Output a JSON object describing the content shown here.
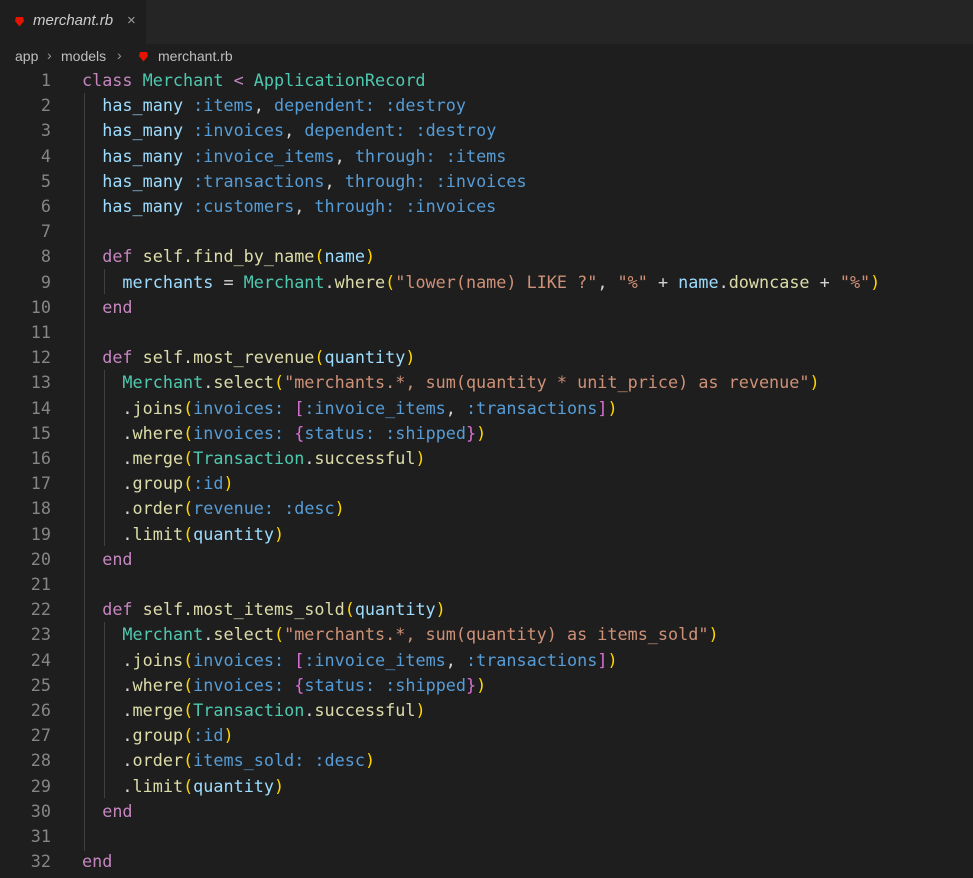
{
  "tab": {
    "title": "merchant.rb",
    "close": "×"
  },
  "breadcrumb": {
    "items": [
      "app",
      "models",
      "merchant.rb"
    ],
    "separator": "›"
  },
  "colors": {
    "background": "#1e1e1e",
    "keyword": "#c586c0",
    "type": "#4ec9b0",
    "symbol": "#569cd6",
    "function": "#dcdcaa",
    "variable": "#9cdcfe",
    "string": "#ce9178",
    "ruby_icon": "#e51400"
  },
  "lines": [
    {
      "n": "1",
      "t": [
        [
          "kw",
          "class "
        ],
        [
          "ty",
          "Merchant"
        ],
        [
          "pl",
          " "
        ],
        [
          "kw",
          "<"
        ],
        [
          "pl",
          " "
        ],
        [
          "ty",
          "ApplicationRecord"
        ]
      ]
    },
    {
      "n": "2",
      "t": [
        [
          "pl",
          "  "
        ],
        [
          "var",
          "has_many"
        ],
        [
          "pl",
          " "
        ],
        [
          "sym",
          ":items"
        ],
        [
          "pl",
          ", "
        ],
        [
          "sym",
          "dependent:"
        ],
        [
          "pl",
          " "
        ],
        [
          "sym",
          ":destroy"
        ]
      ]
    },
    {
      "n": "3",
      "t": [
        [
          "pl",
          "  "
        ],
        [
          "var",
          "has_many"
        ],
        [
          "pl",
          " "
        ],
        [
          "sym",
          ":invoices"
        ],
        [
          "pl",
          ", "
        ],
        [
          "sym",
          "dependent:"
        ],
        [
          "pl",
          " "
        ],
        [
          "sym",
          ":destroy"
        ]
      ]
    },
    {
      "n": "4",
      "t": [
        [
          "pl",
          "  "
        ],
        [
          "var",
          "has_many"
        ],
        [
          "pl",
          " "
        ],
        [
          "sym",
          ":invoice_items"
        ],
        [
          "pl",
          ", "
        ],
        [
          "sym",
          "through:"
        ],
        [
          "pl",
          " "
        ],
        [
          "sym",
          ":items"
        ]
      ]
    },
    {
      "n": "5",
      "t": [
        [
          "pl",
          "  "
        ],
        [
          "var",
          "has_many"
        ],
        [
          "pl",
          " "
        ],
        [
          "sym",
          ":transactions"
        ],
        [
          "pl",
          ", "
        ],
        [
          "sym",
          "through:"
        ],
        [
          "pl",
          " "
        ],
        [
          "sym",
          ":invoices"
        ]
      ]
    },
    {
      "n": "6",
      "t": [
        [
          "pl",
          "  "
        ],
        [
          "var",
          "has_many"
        ],
        [
          "pl",
          " "
        ],
        [
          "sym",
          ":customers"
        ],
        [
          "pl",
          ", "
        ],
        [
          "sym",
          "through:"
        ],
        [
          "pl",
          " "
        ],
        [
          "sym",
          ":invoices"
        ]
      ]
    },
    {
      "n": "7",
      "t": []
    },
    {
      "n": "8",
      "t": [
        [
          "pl",
          "  "
        ],
        [
          "kw",
          "def"
        ],
        [
          "pl",
          " "
        ],
        [
          "fn",
          "self.find_by_name"
        ],
        [
          "br1",
          "("
        ],
        [
          "var",
          "name"
        ],
        [
          "br1",
          ")"
        ]
      ]
    },
    {
      "n": "9",
      "t": [
        [
          "pl",
          "    "
        ],
        [
          "var",
          "merchants"
        ],
        [
          "pl",
          " = "
        ],
        [
          "ty",
          "Merchant"
        ],
        [
          "pl",
          "."
        ],
        [
          "fn",
          "where"
        ],
        [
          "br1",
          "("
        ],
        [
          "str",
          "\"lower(name) LIKE ?\""
        ],
        [
          "pl",
          ", "
        ],
        [
          "str",
          "\"%\""
        ],
        [
          "pl",
          " + "
        ],
        [
          "var",
          "name"
        ],
        [
          "pl",
          "."
        ],
        [
          "fn",
          "downcase"
        ],
        [
          "pl",
          " + "
        ],
        [
          "str",
          "\"%\""
        ],
        [
          "br1",
          ")"
        ]
      ]
    },
    {
      "n": "10",
      "t": [
        [
          "pl",
          "  "
        ],
        [
          "kw",
          "end"
        ]
      ]
    },
    {
      "n": "11",
      "t": []
    },
    {
      "n": "12",
      "t": [
        [
          "pl",
          "  "
        ],
        [
          "kw",
          "def"
        ],
        [
          "pl",
          " "
        ],
        [
          "fn",
          "self.most_revenue"
        ],
        [
          "br1",
          "("
        ],
        [
          "var",
          "quantity"
        ],
        [
          "br1",
          ")"
        ]
      ]
    },
    {
      "n": "13",
      "t": [
        [
          "pl",
          "    "
        ],
        [
          "ty",
          "Merchant"
        ],
        [
          "pl",
          "."
        ],
        [
          "fn",
          "select"
        ],
        [
          "br1",
          "("
        ],
        [
          "str",
          "\"merchants.*, sum(quantity * unit_price) as revenue\""
        ],
        [
          "br1",
          ")"
        ]
      ]
    },
    {
      "n": "14",
      "t": [
        [
          "pl",
          "    ."
        ],
        [
          "fn",
          "joins"
        ],
        [
          "br1",
          "("
        ],
        [
          "sym",
          "invoices:"
        ],
        [
          "pl",
          " "
        ],
        [
          "br2",
          "["
        ],
        [
          "sym",
          ":invoice_items"
        ],
        [
          "pl",
          ", "
        ],
        [
          "sym",
          ":transactions"
        ],
        [
          "br2",
          "]"
        ],
        [
          "br1",
          ")"
        ]
      ]
    },
    {
      "n": "15",
      "t": [
        [
          "pl",
          "    ."
        ],
        [
          "fn",
          "where"
        ],
        [
          "br1",
          "("
        ],
        [
          "sym",
          "invoices:"
        ],
        [
          "pl",
          " "
        ],
        [
          "br2",
          "{"
        ],
        [
          "sym",
          "status:"
        ],
        [
          "pl",
          " "
        ],
        [
          "sym",
          ":shipped"
        ],
        [
          "br2",
          "}"
        ],
        [
          "br1",
          ")"
        ]
      ]
    },
    {
      "n": "16",
      "t": [
        [
          "pl",
          "    ."
        ],
        [
          "fn",
          "merge"
        ],
        [
          "br1",
          "("
        ],
        [
          "ty",
          "Transaction"
        ],
        [
          "pl",
          "."
        ],
        [
          "fn",
          "successful"
        ],
        [
          "br1",
          ")"
        ]
      ]
    },
    {
      "n": "17",
      "t": [
        [
          "pl",
          "    ."
        ],
        [
          "fn",
          "group"
        ],
        [
          "br1",
          "("
        ],
        [
          "sym",
          ":id"
        ],
        [
          "br1",
          ")"
        ]
      ]
    },
    {
      "n": "18",
      "t": [
        [
          "pl",
          "    ."
        ],
        [
          "fn",
          "order"
        ],
        [
          "br1",
          "("
        ],
        [
          "sym",
          "revenue:"
        ],
        [
          "pl",
          " "
        ],
        [
          "sym",
          ":desc"
        ],
        [
          "br1",
          ")"
        ]
      ]
    },
    {
      "n": "19",
      "t": [
        [
          "pl",
          "    ."
        ],
        [
          "fn",
          "limit"
        ],
        [
          "br1",
          "("
        ],
        [
          "var",
          "quantity"
        ],
        [
          "br1",
          ")"
        ]
      ]
    },
    {
      "n": "20",
      "t": [
        [
          "pl",
          "  "
        ],
        [
          "kw",
          "end"
        ]
      ]
    },
    {
      "n": "21",
      "t": []
    },
    {
      "n": "22",
      "t": [
        [
          "pl",
          "  "
        ],
        [
          "kw",
          "def"
        ],
        [
          "pl",
          " "
        ],
        [
          "fn",
          "self.most_items_sold"
        ],
        [
          "br1",
          "("
        ],
        [
          "var",
          "quantity"
        ],
        [
          "br1",
          ")"
        ]
      ]
    },
    {
      "n": "23",
      "t": [
        [
          "pl",
          "    "
        ],
        [
          "ty",
          "Merchant"
        ],
        [
          "pl",
          "."
        ],
        [
          "fn",
          "select"
        ],
        [
          "br1",
          "("
        ],
        [
          "str",
          "\"merchants.*, sum(quantity) as items_sold\""
        ],
        [
          "br1",
          ")"
        ]
      ]
    },
    {
      "n": "24",
      "t": [
        [
          "pl",
          "    ."
        ],
        [
          "fn",
          "joins"
        ],
        [
          "br1",
          "("
        ],
        [
          "sym",
          "invoices:"
        ],
        [
          "pl",
          " "
        ],
        [
          "br2",
          "["
        ],
        [
          "sym",
          ":invoice_items"
        ],
        [
          "pl",
          ", "
        ],
        [
          "sym",
          ":transactions"
        ],
        [
          "br2",
          "]"
        ],
        [
          "br1",
          ")"
        ]
      ]
    },
    {
      "n": "25",
      "t": [
        [
          "pl",
          "    ."
        ],
        [
          "fn",
          "where"
        ],
        [
          "br1",
          "("
        ],
        [
          "sym",
          "invoices:"
        ],
        [
          "pl",
          " "
        ],
        [
          "br2",
          "{"
        ],
        [
          "sym",
          "status:"
        ],
        [
          "pl",
          " "
        ],
        [
          "sym",
          ":shipped"
        ],
        [
          "br2",
          "}"
        ],
        [
          "br1",
          ")"
        ]
      ]
    },
    {
      "n": "26",
      "t": [
        [
          "pl",
          "    ."
        ],
        [
          "fn",
          "merge"
        ],
        [
          "br1",
          "("
        ],
        [
          "ty",
          "Transaction"
        ],
        [
          "pl",
          "."
        ],
        [
          "fn",
          "successful"
        ],
        [
          "br1",
          ")"
        ]
      ]
    },
    {
      "n": "27",
      "t": [
        [
          "pl",
          "    ."
        ],
        [
          "fn",
          "group"
        ],
        [
          "br1",
          "("
        ],
        [
          "sym",
          ":id"
        ],
        [
          "br1",
          ")"
        ]
      ]
    },
    {
      "n": "28",
      "t": [
        [
          "pl",
          "    ."
        ],
        [
          "fn",
          "order"
        ],
        [
          "br1",
          "("
        ],
        [
          "sym",
          "items_sold:"
        ],
        [
          "pl",
          " "
        ],
        [
          "sym",
          ":desc"
        ],
        [
          "br1",
          ")"
        ]
      ]
    },
    {
      "n": "29",
      "t": [
        [
          "pl",
          "    ."
        ],
        [
          "fn",
          "limit"
        ],
        [
          "br1",
          "("
        ],
        [
          "var",
          "quantity"
        ],
        [
          "br1",
          ")"
        ]
      ]
    },
    {
      "n": "30",
      "t": [
        [
          "pl",
          "  "
        ],
        [
          "kw",
          "end"
        ]
      ]
    },
    {
      "n": "31",
      "t": []
    },
    {
      "n": "32",
      "t": [
        [
          "kw",
          "end"
        ]
      ]
    }
  ]
}
